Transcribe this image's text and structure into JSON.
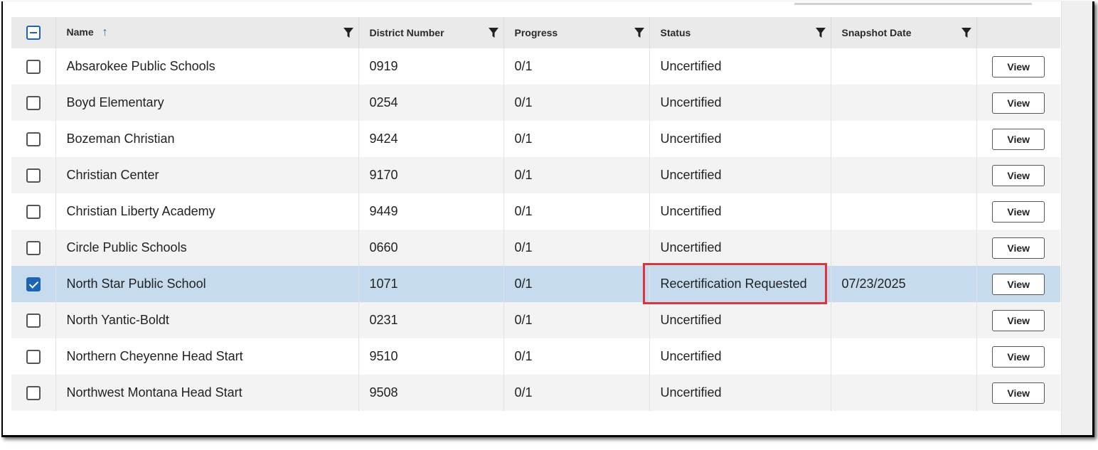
{
  "table": {
    "columns": [
      {
        "label": "Name",
        "sort": "ascending"
      },
      {
        "label": "District Number"
      },
      {
        "label": "Progress"
      },
      {
        "label": "Status"
      },
      {
        "label": "Snapshot Date"
      }
    ],
    "view_label": "View",
    "rows": [
      {
        "checked": false,
        "name": "Absarokee Public Schools",
        "district_number": "0919",
        "progress": "0/1",
        "status": "Uncertified",
        "snapshot_date": ""
      },
      {
        "checked": false,
        "name": "Boyd Elementary",
        "district_number": "0254",
        "progress": "0/1",
        "status": "Uncertified",
        "snapshot_date": ""
      },
      {
        "checked": false,
        "name": "Bozeman Christian",
        "district_number": "9424",
        "progress": "0/1",
        "status": "Uncertified",
        "snapshot_date": ""
      },
      {
        "checked": false,
        "name": "Christian Center",
        "district_number": "9170",
        "progress": "0/1",
        "status": "Uncertified",
        "snapshot_date": ""
      },
      {
        "checked": false,
        "name": "Christian Liberty Academy",
        "district_number": "9449",
        "progress": "0/1",
        "status": "Uncertified",
        "snapshot_date": ""
      },
      {
        "checked": false,
        "name": "Circle Public Schools",
        "district_number": "0660",
        "progress": "0/1",
        "status": "Uncertified",
        "snapshot_date": ""
      },
      {
        "checked": true,
        "name": "North Star Public School",
        "district_number": "1071",
        "progress": "0/1",
        "status": "Recertification Requested",
        "snapshot_date": "07/23/2025"
      },
      {
        "checked": false,
        "name": "North Yantic-Boldt",
        "district_number": "0231",
        "progress": "0/1",
        "status": "Uncertified",
        "snapshot_date": ""
      },
      {
        "checked": false,
        "name": "Northern Cheyenne Head Start",
        "district_number": "9510",
        "progress": "0/1",
        "status": "Uncertified",
        "snapshot_date": ""
      },
      {
        "checked": false,
        "name": "Northwest Montana Head Start",
        "district_number": "9508",
        "progress": "0/1",
        "status": "Uncertified",
        "snapshot_date": ""
      }
    ]
  },
  "colors": {
    "accent": "#1c64b4",
    "selected_row": "#c6dbee",
    "highlight_border": "#e0333e"
  }
}
